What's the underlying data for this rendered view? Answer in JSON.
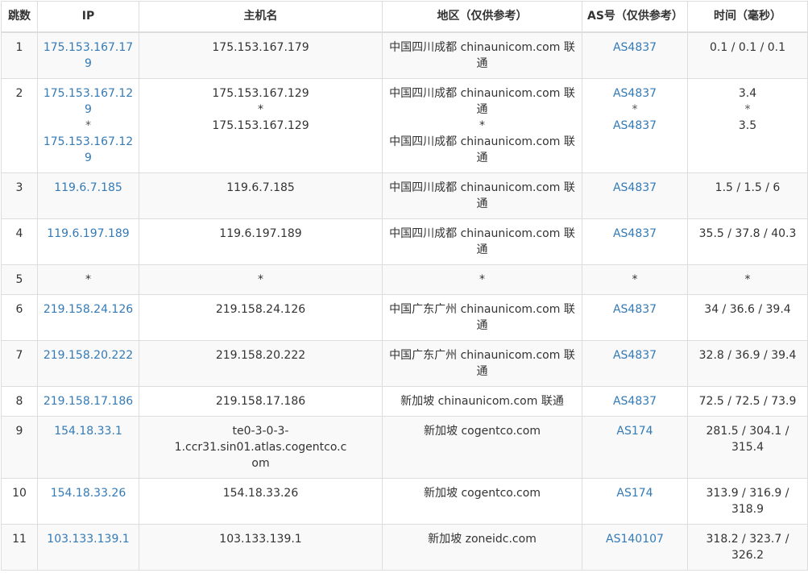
{
  "headers": {
    "hop": "跳数",
    "ip": "IP",
    "host": "主机名",
    "region": "地区（仅供参考）",
    "as": "AS号（仅供参考）",
    "time": "时间（毫秒）"
  },
  "rows": [
    {
      "hop": "1",
      "ip": "175.153.167.179",
      "host": "175.153.167.179",
      "region": "中国四川成都 chinaunicom.com 联通",
      "as": "AS4837",
      "time": "0.1 / 0.1 / 0.1"
    },
    {
      "hop": "2",
      "ip": "175.153.167.129",
      "ip_sep": "*",
      "ip2": "175.153.167.129",
      "host": "175.153.167.129",
      "host_sep": "*",
      "host2": "175.153.167.129",
      "region": "中国四川成都 chinaunicom.com 联通",
      "region_sep": "*",
      "region2": "中国四川成都 chinaunicom.com 联通",
      "as": "AS4837",
      "as_sep": "*",
      "as2": "AS4837",
      "time": "3.4",
      "time_sep": "*",
      "time2": "3.5"
    },
    {
      "hop": "3",
      "ip": "119.6.7.185",
      "host": "119.6.7.185",
      "region": "中国四川成都 chinaunicom.com 联通",
      "as": "AS4837",
      "time": "1.5 / 1.5 / 6"
    },
    {
      "hop": "4",
      "ip": "119.6.197.189",
      "host": "119.6.197.189",
      "region": "中国四川成都 chinaunicom.com 联通",
      "as": "AS4837",
      "time": "35.5 / 37.8 / 40.3"
    },
    {
      "hop": "5",
      "ip": "*",
      "host": "*",
      "region": "*",
      "as": "*",
      "time": "*"
    },
    {
      "hop": "6",
      "ip": "219.158.24.126",
      "host": "219.158.24.126",
      "region": "中国广东广州 chinaunicom.com 联通",
      "as": "AS4837",
      "time": "34 / 36.6 / 39.4"
    },
    {
      "hop": "7",
      "ip": "219.158.20.222",
      "host": "219.158.20.222",
      "region": "中国广东广州 chinaunicom.com 联通",
      "as": "AS4837",
      "time": "32.8 / 36.9 / 39.4"
    },
    {
      "hop": "8",
      "ip": "219.158.17.186",
      "host": "219.158.17.186",
      "region": "新加坡 chinaunicom.com 联通",
      "as": "AS4837",
      "time": "72.5 / 72.5 / 73.9"
    },
    {
      "hop": "9",
      "ip": "154.18.33.1",
      "host": "te0-3-0-3-1.ccr31.sin01.atlas.cogentco.com",
      "region": "新加坡 cogentco.com",
      "as": "AS174",
      "time": "281.5 / 304.1 / 315.4"
    },
    {
      "hop": "10",
      "ip": "154.18.33.26",
      "host": "154.18.33.26",
      "region": "新加坡 cogentco.com",
      "as": "AS174",
      "time": "313.9 / 316.9 / 318.9"
    },
    {
      "hop": "11",
      "ip": "103.133.139.1",
      "host": "103.133.139.1",
      "region": "新加坡 zoneidc.com",
      "as": "AS140107",
      "time": "318.2 / 323.7 / 326.2"
    }
  ],
  "colors": {
    "link": "#337ab7",
    "text": "#333333",
    "border": "#dddddd",
    "stripe": "#f9f9f9"
  }
}
